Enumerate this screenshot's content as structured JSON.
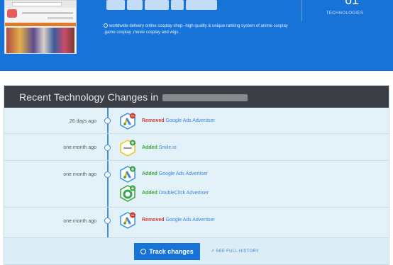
{
  "hero": {
    "description": "worldwide delivery online cosplay shop--high quality & unique ranking system of anime cosplay ,game cosplay ,movie cosplay and wigs .",
    "tech_count": "61",
    "tech_label": "TECHNOLOGIES"
  },
  "changes": {
    "title": "Recent Technology Changes in",
    "rows": [
      {
        "date": "26 days ago",
        "entries": [
          {
            "action": "Removed",
            "name": "Google Ads Advertiser",
            "icon": "google-ads-icon"
          }
        ]
      },
      {
        "date": "one month ago",
        "entries": [
          {
            "action": "Added",
            "name": "Smile.io",
            "icon": "smile-io-icon"
          }
        ]
      },
      {
        "date": "one month ago",
        "entries": [
          {
            "action": "Added",
            "name": "Google Ads Advertiser",
            "icon": "google-ads-icon"
          },
          {
            "action": "Added",
            "name": "DoubleClick Advertiser",
            "icon": "doubleclick-icon"
          }
        ]
      },
      {
        "date": "one month ago",
        "entries": [
          {
            "action": "Removed",
            "name": "Google Ads Advertiser",
            "icon": "google-ads-icon"
          }
        ]
      }
    ],
    "track_label": "Track changes",
    "history_label": "SEE FULL HISTORY"
  },
  "colors": {
    "brand_blue": "#1873d9",
    "removed_red": "#d63a2f",
    "added_green": "#3aa63a",
    "header_dark": "#3b3f45"
  }
}
